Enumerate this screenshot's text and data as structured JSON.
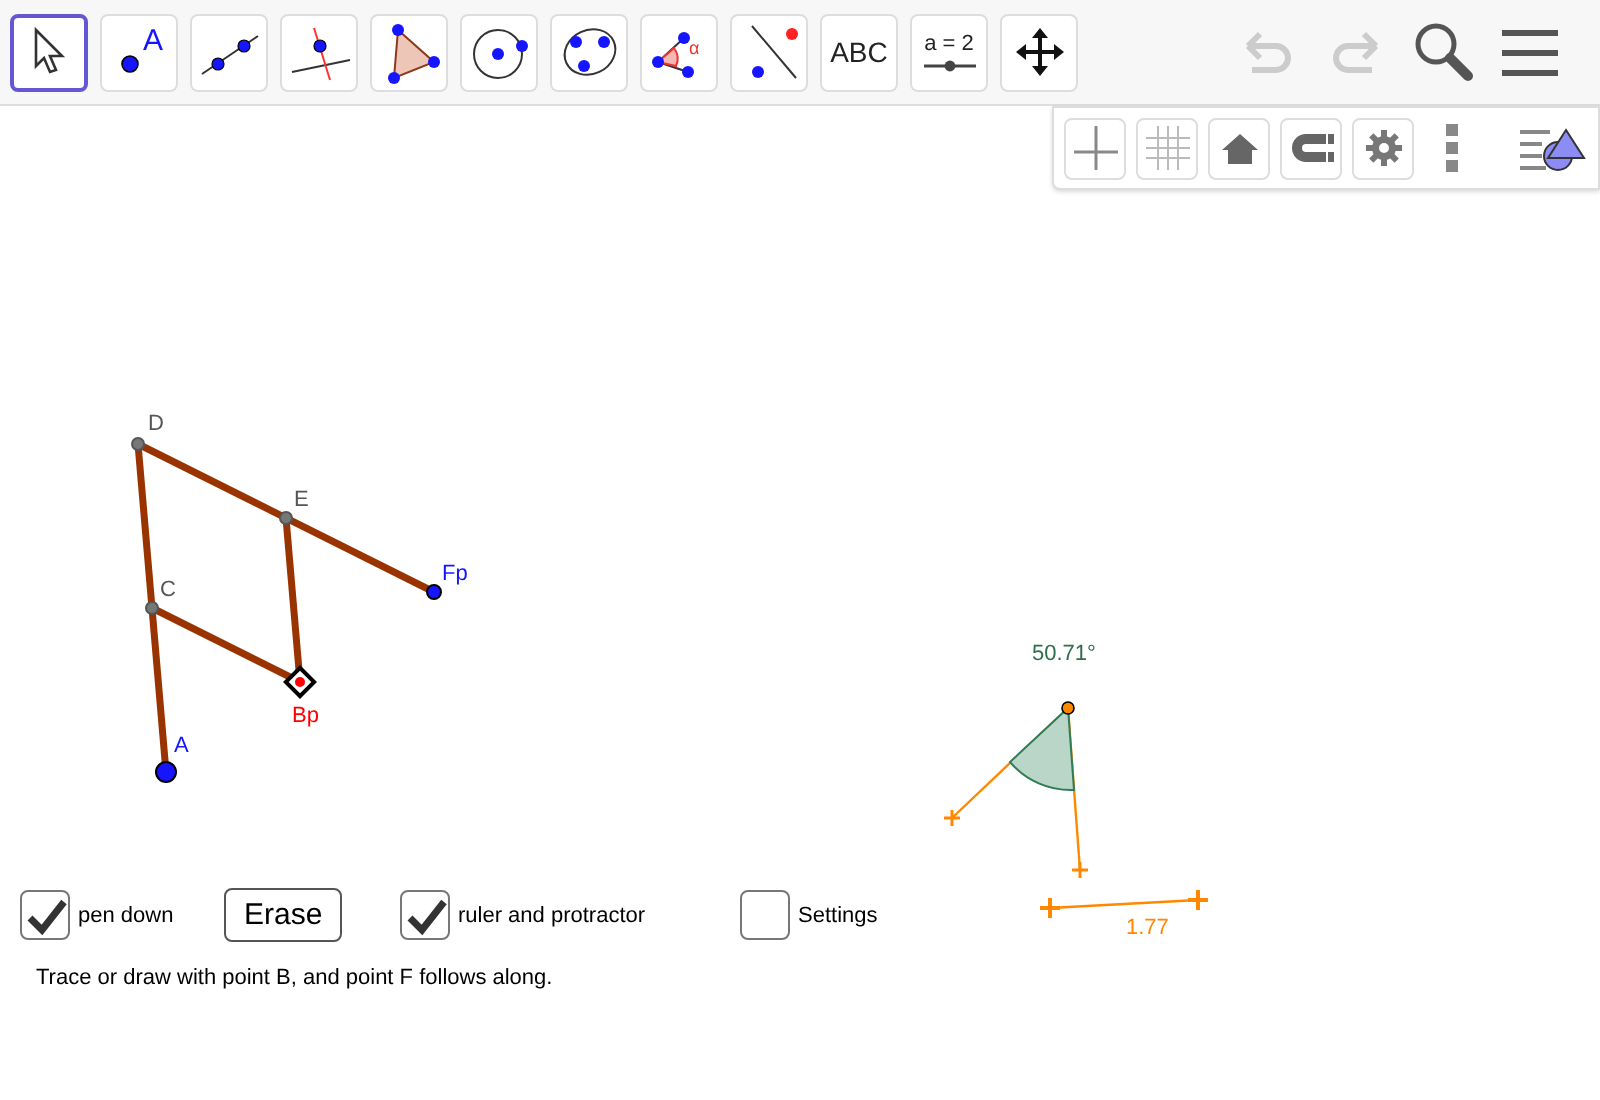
{
  "toolbar": {
    "tools": [
      {
        "kind": "move",
        "selected": true
      },
      {
        "kind": "point",
        "selected": false,
        "text": "A"
      },
      {
        "kind": "line",
        "selected": false
      },
      {
        "kind": "perpendicular",
        "selected": false
      },
      {
        "kind": "polygon",
        "selected": false
      },
      {
        "kind": "circle",
        "selected": false
      },
      {
        "kind": "conic",
        "selected": false
      },
      {
        "kind": "angle",
        "selected": false,
        "text": "α"
      },
      {
        "kind": "reflect",
        "selected": false
      },
      {
        "kind": "text",
        "selected": false,
        "text": "ABC"
      },
      {
        "kind": "slider",
        "selected": false,
        "text": "a = 2"
      },
      {
        "kind": "move_view",
        "selected": false
      }
    ],
    "actions": [
      {
        "kind": "undo",
        "disabled": true
      },
      {
        "kind": "redo",
        "disabled": true
      },
      {
        "kind": "search",
        "disabled": false
      },
      {
        "kind": "menu",
        "disabled": false
      }
    ]
  },
  "style_bar": [
    {
      "kind": "axes"
    },
    {
      "kind": "grid"
    },
    {
      "kind": "home"
    },
    {
      "kind": "magnet"
    },
    {
      "kind": "settings"
    },
    {
      "kind": "more"
    },
    {
      "kind": "algebra"
    }
  ],
  "canvas": {
    "points": [
      {
        "label": "D",
        "color": "#555555"
      },
      {
        "label": "E",
        "color": "#555555"
      },
      {
        "label": "Fp",
        "color": "#1515ff"
      },
      {
        "label": "C",
        "color": "#555555"
      },
      {
        "label": "Bp",
        "color": "#ff0000"
      },
      {
        "label": "A",
        "color": "#1515ff"
      }
    ],
    "angle_reading": "50.71°",
    "length_reading": "1.77"
  },
  "controls": [
    {
      "kind": "checkbox",
      "label": "pen down",
      "checked": true
    },
    {
      "kind": "button",
      "label": "Erase"
    },
    {
      "kind": "checkbox",
      "label": "ruler and protractor",
      "checked": true
    },
    {
      "kind": "checkbox",
      "label": "Settings",
      "checked": false
    }
  ],
  "caption": "Trace or draw with point B, and point F follows along."
}
